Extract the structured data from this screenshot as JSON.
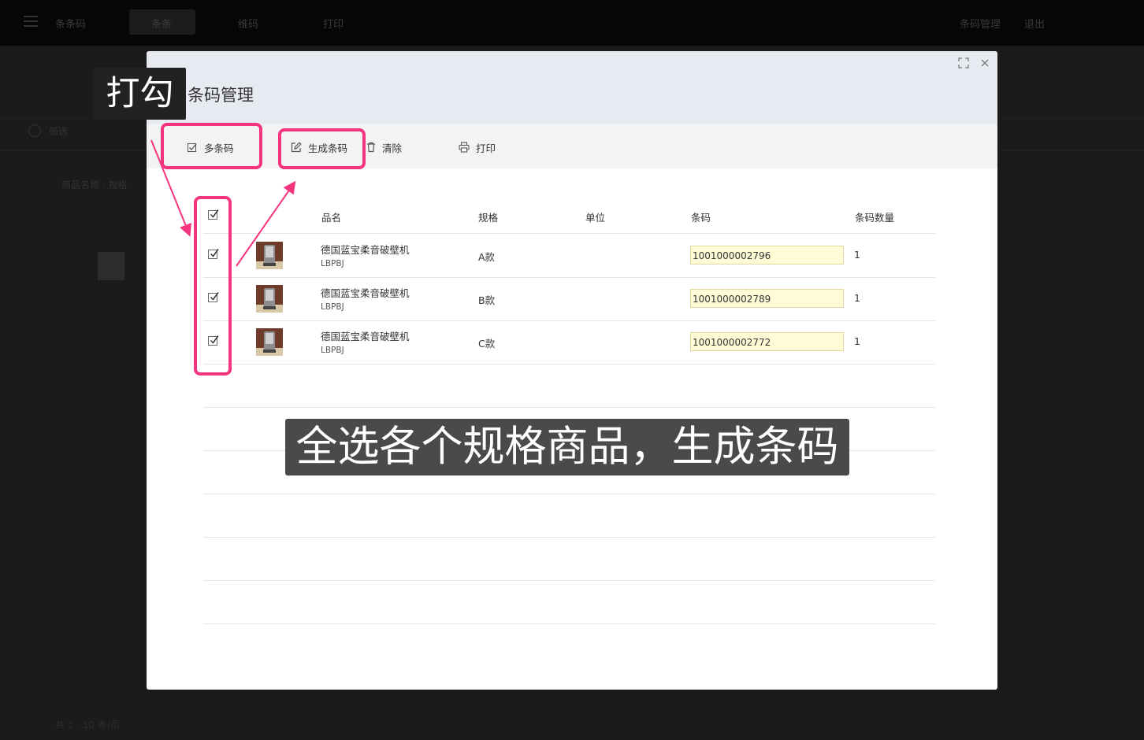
{
  "background_app": {
    "nav_items": [
      "条条码",
      "条条",
      "维码",
      "打印"
    ],
    "right_items": [
      "条码管理",
      "退出"
    ],
    "filter_label": "筛选",
    "list_label": "商品名称 · 规格",
    "footer": "共 1 · 10 条/页"
  },
  "modal": {
    "title": "条码管理",
    "toolbar": {
      "multi_barcode": "多条码",
      "generate_barcode": "生成条码",
      "clear": "清除",
      "print": "打印"
    },
    "table": {
      "headers": {
        "name": "品名",
        "spec": "规格",
        "unit": "单位",
        "barcode": "条码",
        "barcode_qty": "条码数量"
      },
      "rows": [
        {
          "checked": true,
          "name": "德国蓝宝柔音破壁机",
          "code": "LBPBJ",
          "spec": "A款",
          "unit": "",
          "barcode": "1001000002796",
          "qty": "1"
        },
        {
          "checked": true,
          "name": "德国蓝宝柔音破壁机",
          "code": "LBPBJ",
          "spec": "B款",
          "unit": "",
          "barcode": "1001000002789",
          "qty": "1"
        },
        {
          "checked": true,
          "name": "德国蓝宝柔音破壁机",
          "code": "LBPBJ",
          "spec": "C款",
          "unit": "",
          "barcode": "1001000002772",
          "qty": "1"
        }
      ]
    }
  },
  "annotations": {
    "check_label": "打勾",
    "subtitle": "全选各个规格商品，生成条码",
    "highlight_color": "#f5347f"
  }
}
